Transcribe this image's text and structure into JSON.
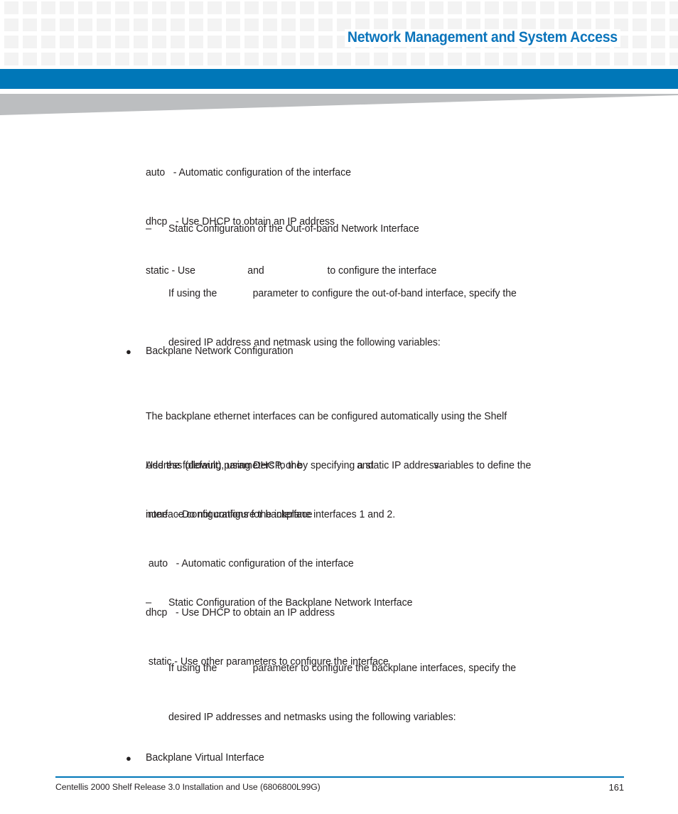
{
  "header": {
    "title": "Network Management and System Access",
    "accent_color": "#0077b8",
    "title_color": "#0a74bb",
    "pattern_color": "#f3f3f3"
  },
  "body": {
    "oob_options": {
      "line1": "auto   - Automatic configuration of the interface",
      "line2": "dhcp   - Use DHCP to obtain an IP address",
      "line3_a": "static - Use ",
      "line3_gap1": "                  ",
      "line3_b": "and ",
      "line3_gap2": "                      ",
      "line3_c": "to configure the interface"
    },
    "oob_static": {
      "marker": "–",
      "heading": "Static Configuration of the Out-of-band Network Interface",
      "para_a": "If using the ",
      "para_gap": "            ",
      "para_b": "parameter to configure the out-of-band interface, specify the",
      "para_line2": "desired IP address and netmask using the following variables:"
    },
    "backplane": {
      "marker": "●",
      "heading": "Backplane Network Configuration",
      "para1_line1": "The backplane ethernet interfaces can be configured automatically using the Shelf",
      "para1_line2": "Address (default), using DHCP, or by specifying a static IP address.",
      "para2_a": "Use the following parameters to the ",
      "para2_gap1": "                   ",
      "para2_b": "and ",
      "para2_gap2": "                     ",
      "para2_c": "variables to define the",
      "para2_line2": "interface configurations for backplane interfaces 1 and 2.",
      "options": [
        "none   - Do not configure the interface",
        " auto   - Automatic configuration of the interface",
        "dhcp   - Use DHCP to obtain an IP address",
        " static - Use other parameters to configure the interface"
      ]
    },
    "backplane_static": {
      "marker": "–",
      "heading": "Static Configuration of the Backplane Network Interface",
      "para_a": "If using the ",
      "para_gap": "            ",
      "para_b": "parameter to configure the backplane interfaces, specify the",
      "para_line2": "desired IP addresses and netmasks using the following variables:"
    },
    "virtual": {
      "marker": "●",
      "heading": "Backplane Virtual Interface"
    }
  },
  "footer": {
    "document": "Centellis 2000 Shelf Release 3.0 Installation and Use (6806800L99G)",
    "page_number": "161",
    "rule_color": "#0077b8"
  }
}
